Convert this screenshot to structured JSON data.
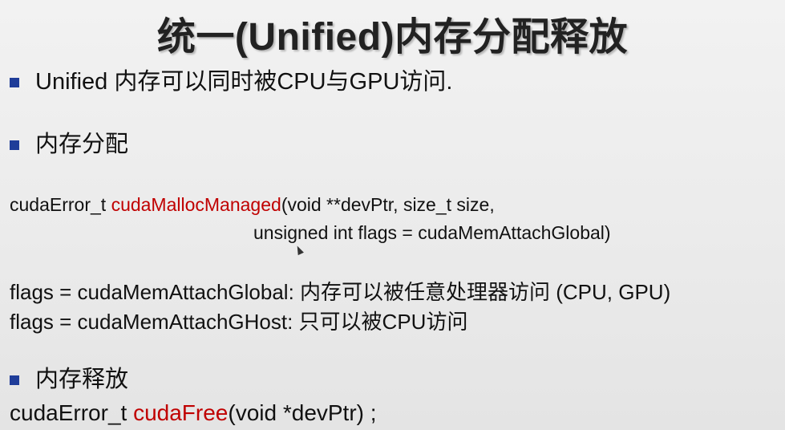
{
  "title": "统一(Unified)内存分配释放",
  "bullets": {
    "unified_text": "Unified 内存可以同时被CPU与GPU访问.",
    "alloc_heading": "内存分配",
    "free_heading": "内存释放"
  },
  "code": {
    "malloc_prefix": "cudaError_t ",
    "malloc_func": "cudaMallocManaged",
    "malloc_args_1": "(void **devPtr, size_t size,",
    "malloc_args_2": "unsigned int  flags = cudaMemAttachGlobal)",
    "flag_global": "flags = cudaMemAttachGlobal: 内存可以被任意处理器访问 (CPU, GPU)",
    "flag_host": "flags = cudaMemAttachGHost: 只可以被CPU访问",
    "free_prefix": "cudaError_t ",
    "free_func": "cudaFree",
    "free_args": "(void *devPtr) ;"
  },
  "colors": {
    "bullet": "#1f3d99",
    "function_name": "#c00000"
  }
}
